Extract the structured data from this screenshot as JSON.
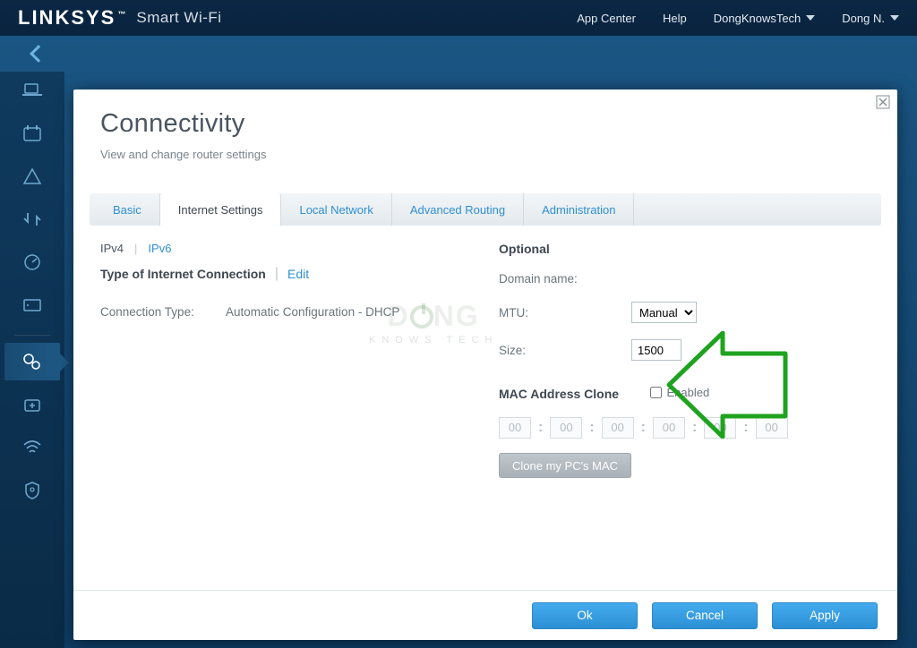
{
  "header": {
    "brand": "LINKSYS",
    "brand_tm": "™",
    "brand_sub": "Smart Wi-Fi",
    "nav": {
      "app_center": "App Center",
      "help": "Help",
      "account": "DongKnowsTech",
      "user": "Dong N."
    }
  },
  "panel": {
    "title": "Connectivity",
    "desc": "View and change router settings",
    "tabs": {
      "basic": "Basic",
      "internet": "Internet Settings",
      "local": "Local Network",
      "routing": "Advanced Routing",
      "admin": "Administration"
    },
    "ipv4": "IPv4",
    "ipv6": "IPv6",
    "left": {
      "heading": "Type of Internet Connection",
      "edit": "Edit",
      "conn_type_label": "Connection Type:",
      "conn_type_value": "Automatic Configuration - DHCP"
    },
    "right": {
      "heading": "Optional",
      "domain_label": "Domain name:",
      "domain_value": "",
      "mtu_label": "MTU:",
      "mtu_value": "Manual",
      "size_label": "Size:",
      "size_value": "1500",
      "mac_heading": "MAC Address Clone",
      "mac_enabled_label": "Enabled",
      "mac_octets": [
        "00",
        "00",
        "00",
        "00",
        "00",
        "00"
      ],
      "clone_label": "Clone my PC's MAC"
    },
    "footer": {
      "ok": "Ok",
      "cancel": "Cancel",
      "apply": "Apply"
    }
  },
  "watermark": {
    "top": "D  NG",
    "sub": "KNOWS TECH"
  }
}
